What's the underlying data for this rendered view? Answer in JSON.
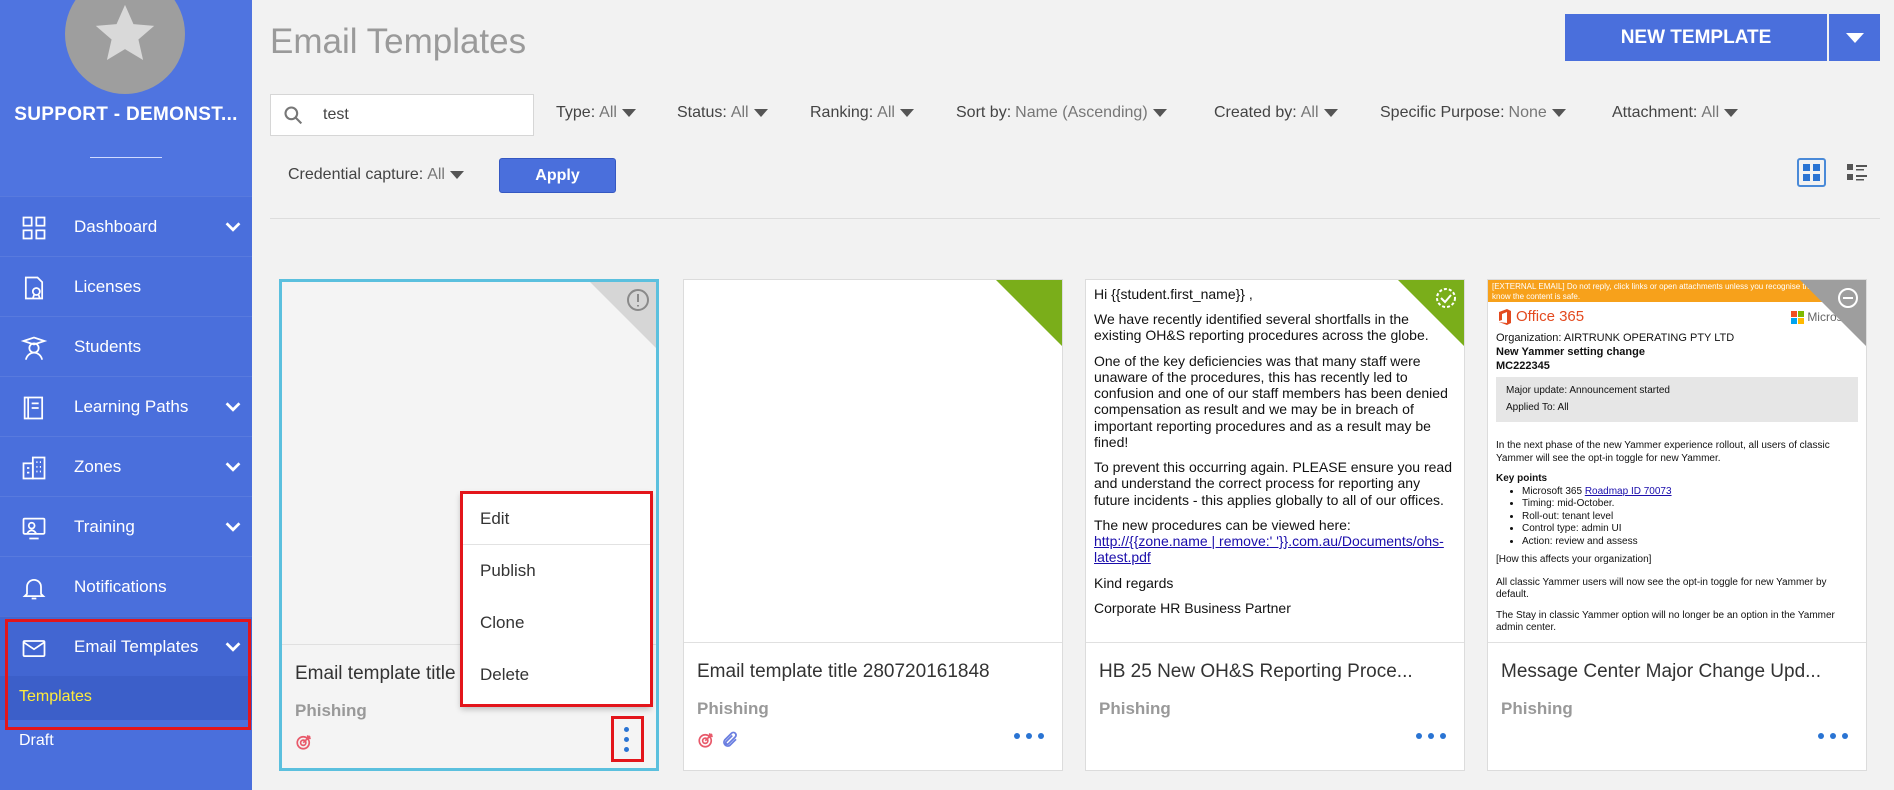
{
  "sidebar": {
    "org_name": "SUPPORT - DEMONST...",
    "items": [
      {
        "label": "Dashboard",
        "icon": "dashboard-icon",
        "expandable": true
      },
      {
        "label": "Licenses",
        "icon": "license-icon",
        "expandable": false
      },
      {
        "label": "Students",
        "icon": "student-icon",
        "expandable": false
      },
      {
        "label": "Learning Paths",
        "icon": "learning-paths-icon",
        "expandable": true
      },
      {
        "label": "Zones",
        "icon": "zones-icon",
        "expandable": true
      },
      {
        "label": "Training",
        "icon": "training-icon",
        "expandable": true
      },
      {
        "label": "Notifications",
        "icon": "bell-icon",
        "expandable": false
      },
      {
        "label": "Email Templates",
        "icon": "envelope-icon",
        "expandable": true
      }
    ],
    "sub_items": [
      {
        "label": "Templates"
      },
      {
        "label": "Draft"
      }
    ]
  },
  "header": {
    "title": "Email Templates",
    "new_template_label": "NEW TEMPLATE"
  },
  "search": {
    "value": "test"
  },
  "filters": [
    {
      "label": "Type:",
      "value": "All"
    },
    {
      "label": "Status:",
      "value": "All"
    },
    {
      "label": "Ranking:",
      "value": "All"
    },
    {
      "label": "Sort by:",
      "value": "Name (Ascending)"
    },
    {
      "label": "Created by:",
      "value": "All"
    },
    {
      "label": "Specific Purpose:",
      "value": "None"
    },
    {
      "label": "Attachment:",
      "value": "All"
    },
    {
      "label": "Credential capture:",
      "value": "All"
    }
  ],
  "apply_label": "Apply",
  "cards": [
    {
      "title": "Email template title 280720141833",
      "type": "Phishing",
      "status_icon": "warning-icon"
    },
    {
      "title": "Email template title 280720161848",
      "type": "Phishing",
      "status_icon": "published-icon"
    },
    {
      "title": "HB 25 New OH&S Reporting Proce...",
      "type": "Phishing",
      "status_icon": "check-circle-icon"
    },
    {
      "title": "Message Center Major Change Upd...",
      "type": "Phishing",
      "status_icon": "minus-circle-icon"
    }
  ],
  "card3_preview": {
    "greeting": "Hi {{student.first_name}} ,",
    "p1": "We have recently identified several shortfalls in the existing OH&S reporting procedures across the globe.",
    "p2": "One of the key deficiencies was that many staff were unaware of the procedures, this has recently led to confusion and one of our staff members has been denied compensation as result and we may be in breach of important reporting procedures and as a result may be fined!",
    "p3": "To prevent this occurring again. PLEASE ensure you read and understand the correct process for reporting any future incidents - this applies globally to all of our offices.",
    "p4": "The new procedures can be viewed here:",
    "link": "http://{{zone.name | remove:' '}}.com.au/Documents/ohs-latest.pdf",
    "closing": "Kind regards",
    "signoff": "Corporate HR Business Partner"
  },
  "card4_preview": {
    "banner": "[EXTERNAL EMAIL] Do not reply, click links or open attachments unless you recognise the sender and know the content is safe.",
    "o365": "Office 365",
    "ms": "Microsoft",
    "org": "Organization: AIRTRUNK OPERATING PTY LTD",
    "subject": "New Yammer setting change",
    "id": "MC222345",
    "major": "Major update: Announcement started",
    "applied": "Applied To: All",
    "intro": "In the next phase of the new Yammer experience rollout, all users of classic Yammer will see the opt-in toggle for new Yammer.",
    "key_points": "Key points",
    "kp1_prefix": "Microsoft 365 ",
    "kp1_link": "Roadmap ID 70073",
    "kp2": "Timing: mid-October.",
    "kp3": "Roll-out: tenant level",
    "kp4": "Control type: admin UI",
    "kp5": "Action: review and assess",
    "how": "[How this affects your organization]",
    "p_all": "All classic Yammer users will now see the opt-in toggle for new Yammer by default.",
    "p_stay": "The Stay in classic Yammer option will no longer be an option in the Yammer admin center."
  },
  "context_menu": {
    "items": [
      "Edit",
      "Publish",
      "Clone",
      "Delete"
    ]
  },
  "colors": {
    "brand": "#4a6fdc",
    "highlight": "#e3151b",
    "active_sub": "#ffeb3b"
  }
}
